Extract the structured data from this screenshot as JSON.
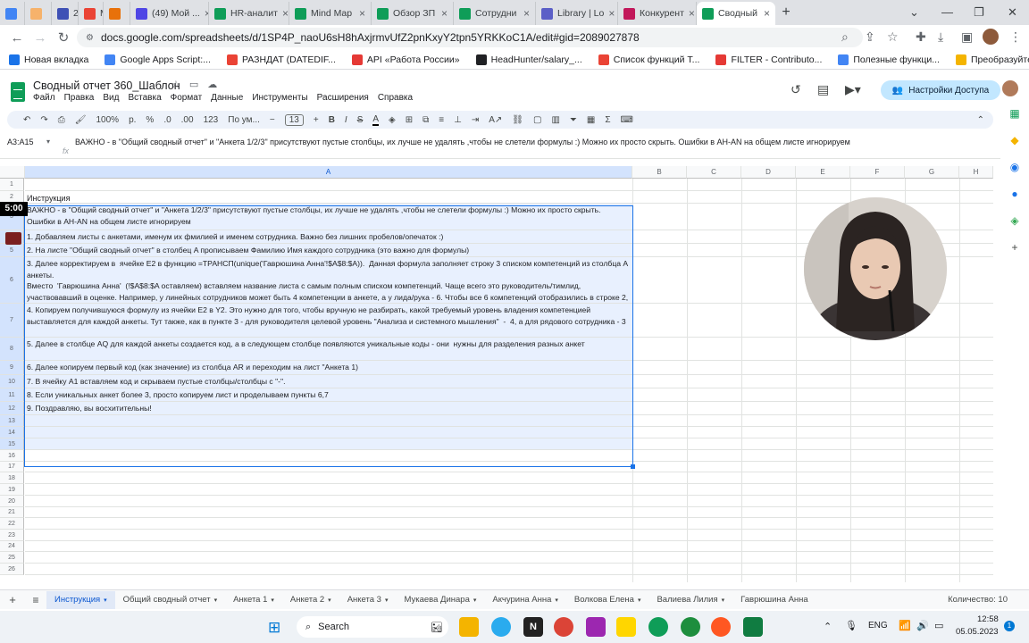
{
  "browser": {
    "tabs": [
      {
        "label": "",
        "color": "#4285f4"
      },
      {
        "label": "",
        "color": "#f6b26b"
      },
      {
        "label": "24",
        "color": "#3f51b5"
      },
      {
        "label": "M",
        "color": "#ea4335"
      },
      {
        "label": "",
        "color": "#e8710a"
      },
      {
        "label": "(49) Мой ...",
        "color": "#4f46e5"
      },
      {
        "label": "HR-аналит",
        "color": "#0f9d58"
      },
      {
        "label": "Mind Map",
        "color": "#0f9d58"
      },
      {
        "label": "Обзор ЗП",
        "color": "#0f9d58"
      },
      {
        "label": "Сотрудни",
        "color": "#0f9d58"
      },
      {
        "label": "Library | Lo",
        "color": "#5b5fc7"
      },
      {
        "label": "Конкурент",
        "color": "#c2185b"
      },
      {
        "label": "Сводный",
        "color": "#0f9d58"
      }
    ],
    "url": "docs.google.com/spreadsheets/d/1SP4P_naoU6sH8hAxjrmvUfZ2pnKxyY2tpn5YRKKoC1A/edit#gid=2089027878",
    "bookmarks": [
      {
        "label": "Новая вкладка",
        "color": "#1a73e8"
      },
      {
        "label": "Google Apps Script:...",
        "color": "#4285f4"
      },
      {
        "label": "РАЗНДАТ (DATEDIF...",
        "color": "#ea4335"
      },
      {
        "label": "API «Работа России»",
        "color": "#e53935"
      },
      {
        "label": "HeadHunter/salary_...",
        "color": "#202124"
      },
      {
        "label": "Список функций Т...",
        "color": "#ea4335"
      },
      {
        "label": "FILTER - Contributo...",
        "color": "#e53935"
      },
      {
        "label": "Полезные функци...",
        "color": "#4285f4"
      },
      {
        "label": "Преобразуйте JSO...",
        "color": "#f4b400"
      }
    ]
  },
  "doc": {
    "title": "Сводный отчет 360_Шаблон",
    "menus": [
      "Файл",
      "Правка",
      "Вид",
      "Вставка",
      "Формат",
      "Данные",
      "Инструменты",
      "Расширения",
      "Справка"
    ],
    "share_label": "Настройки Доступа"
  },
  "toolbar": {
    "zoom": "100%",
    "currency": "р.",
    "percent": "%",
    "dec_less": ".0",
    "dec_more": ".00",
    "format_123": "123",
    "font": "По ум...",
    "font_size": "13"
  },
  "formula_bar": {
    "cell_ref": "A3:A15",
    "fx": "fx",
    "content": "ВАЖНО - в \"Общий сводный отчет\" и \"Анкета 1/2/3\" присутствуют пустые столбцы, их лучше не удалять ,чтобы не слетели формулы :) Можно их просто скрыть. Ошибки в AH-AN на общем листе игнорируем"
  },
  "columns": [
    "A",
    "B",
    "C",
    "D",
    "E",
    "F",
    "G",
    "H"
  ],
  "rows": [
    {
      "num": "1",
      "text": ""
    },
    {
      "num": "2",
      "text": "Инструкция"
    },
    {
      "num": "3",
      "text": "ВАЖНО - в \"Общий сводный отчет\" и \"Анкета 1/2/3\" присутствуют пустые столбцы, их лучше не удалять ,чтобы не слетели формулы :) Можно их просто скрыть. Ошибки в AH-AN на общем листе игнорируем"
    },
    {
      "num": "4",
      "text": "1. Добавляем листы с анкетами, именум их фмилией и именем сотрудника. Важно без лишних пробелов/опечаток :)"
    },
    {
      "num": "5",
      "text": "2. На листе \"Общий сводный отчет\" в столбец A прописываем Фамилию Имя каждого сотрудника (это важно для формулы)"
    },
    {
      "num": "6",
      "text": "3. Далее корректируем в  ячейке E2 в функцию =ТРАНСП(unique('Гаврюшина Анна'!$A$8:$A)).  Данная формула заполняет строку 3 списком компетенций из столбца A анкеты.\nВместо  'Гаврюшина Анна'  (!$A$8:$A оставляем) вставляем название листа с самым полным списком компетенций. Чаще всего это руководитель/тимлид, участвовавший в оценке. Например, у линейных сотрудников может быть 4 компетенции в анкете, а у лида/рука - 6. Чтобы все 6 компетенций отобразились в строке 2, надо выбрать анкету с самым большим набором компетенций :)"
    },
    {
      "num": "7",
      "text": "4. Копируем получившуюся формулу из ячейки E2 в Y2. Это нужно для того, чтобы вручную не разбирать, какой требуемый уровень владения компетенцией выставляется для каждой анкеты. Тут также, как в пункте 3 - для руководителя целевой уровень \"Анализа и системного мышления\"  -  4, а для рядового сотрудника - 3"
    },
    {
      "num": "8",
      "text": "5. Далее в столбце AQ для каждой анкеты создается код, а в следующем столбце появляются уникальные коды - они  нужны для разделения разных анкет"
    },
    {
      "num": "9",
      "text": "6. Далее копируем первый код (как значение) из столбца AR и переходим на лист \"Анкета 1)"
    },
    {
      "num": "10",
      "text": "7. В ячейку A1 вставляем код и скрываем пустые столбцы/столбцы с \"-\"."
    },
    {
      "num": "11",
      "text": "8. Если уникальных анкет более 3, просто копируем лист и проделываем пункты 6,7"
    },
    {
      "num": "12",
      "text": "9. Поздравляю, вы восхитительны!"
    },
    {
      "num": "13",
      "text": ""
    },
    {
      "num": "14",
      "text": ""
    },
    {
      "num": "15",
      "text": ""
    },
    {
      "num": "16",
      "text": ""
    },
    {
      "num": "17",
      "text": ""
    },
    {
      "num": "18",
      "text": ""
    },
    {
      "num": "19",
      "text": ""
    },
    {
      "num": "20",
      "text": ""
    },
    {
      "num": "21",
      "text": ""
    },
    {
      "num": "22",
      "text": ""
    },
    {
      "num": "23",
      "text": ""
    },
    {
      "num": "24",
      "text": ""
    },
    {
      "num": "25",
      "text": ""
    },
    {
      "num": "26",
      "text": ""
    }
  ],
  "timer": "5:00",
  "sheet_tabs": [
    "Инструкция",
    "Общий сводный отчет",
    "Анкета 1",
    "Анкета 2",
    "Анкета 3",
    "Мукаева Динара",
    "Акчурина Анна",
    "Волкова Елена",
    "Валиева Лилия",
    "Гаврюшина Анна"
  ],
  "count_label": "Количество: 10",
  "taskbar": {
    "search": "Search",
    "lang": "ENG",
    "time": "12:58",
    "date": "05.05.2023",
    "notif": "1"
  }
}
